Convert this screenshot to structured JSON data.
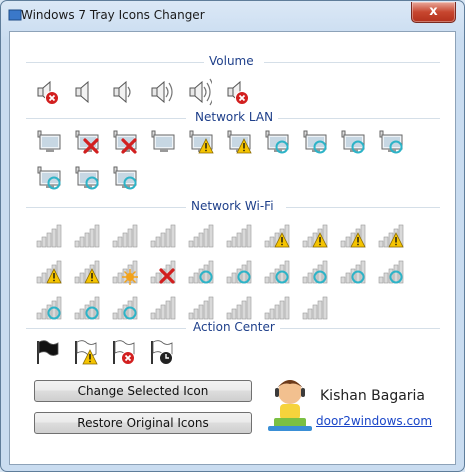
{
  "window": {
    "title": "Windows 7 Tray Icons Changer",
    "close_label": "x"
  },
  "sections": {
    "volume": "Volume",
    "network_lan": "Network LAN",
    "network_wifi": "Network Wi-Fi",
    "action_center": "Action Center"
  },
  "icons": {
    "volume": [
      "speaker-muted-icon",
      "speaker-icon",
      "speaker-low-icon",
      "speaker-medium-icon",
      "speaker-high-icon",
      "speaker-error-icon"
    ],
    "network_lan": [
      "lan-disconnected-icon",
      "lan-error-icon",
      "lan-connected-icon",
      "lan-warning-icon",
      "lan-warning-alt-icon",
      "lan-activity-icon",
      "lan-activity-icon",
      "lan-activity-icon",
      "lan-activity-icon",
      "lan-activity-icon",
      "lan-activity-icon",
      "lan-activity-icon",
      "lan-activity-icon"
    ],
    "network_wifi": [
      "wifi-signal-icon",
      "wifi-signal-icon",
      "wifi-signal-icon",
      "wifi-signal-icon",
      "wifi-signal-icon",
      "wifi-signal-icon",
      "wifi-warning-icon",
      "wifi-warning-icon",
      "wifi-warning-icon",
      "wifi-warning-icon",
      "wifi-warning-icon",
      "wifi-warning-icon",
      "wifi-searching-icon",
      "wifi-error-icon",
      "wifi-activity-icon",
      "wifi-activity-icon",
      "wifi-activity-icon",
      "wifi-activity-icon",
      "wifi-activity-icon",
      "wifi-activity-icon",
      "wifi-activity-icon",
      "wifi-activity-icon",
      "wifi-activity-icon",
      "wifi-signal-icon",
      "wifi-signal-icon",
      "wifi-signal-icon",
      "wifi-signal-icon",
      "wifi-signal-icon"
    ],
    "action_center": [
      "flag-icon",
      "flag-warning-icon",
      "flag-error-icon",
      "flag-clock-icon"
    ]
  },
  "buttons": {
    "change": "Change Selected Icon",
    "restore": "Restore Original Icons"
  },
  "author": {
    "name": "Kishan Bagaria",
    "link": "door2windows.com"
  },
  "colors": {
    "section_label": "#1e3f8a",
    "link": "#1a46c8",
    "error": "#d21f1f",
    "warning": "#f5c400",
    "activity": "#2db3c7"
  }
}
